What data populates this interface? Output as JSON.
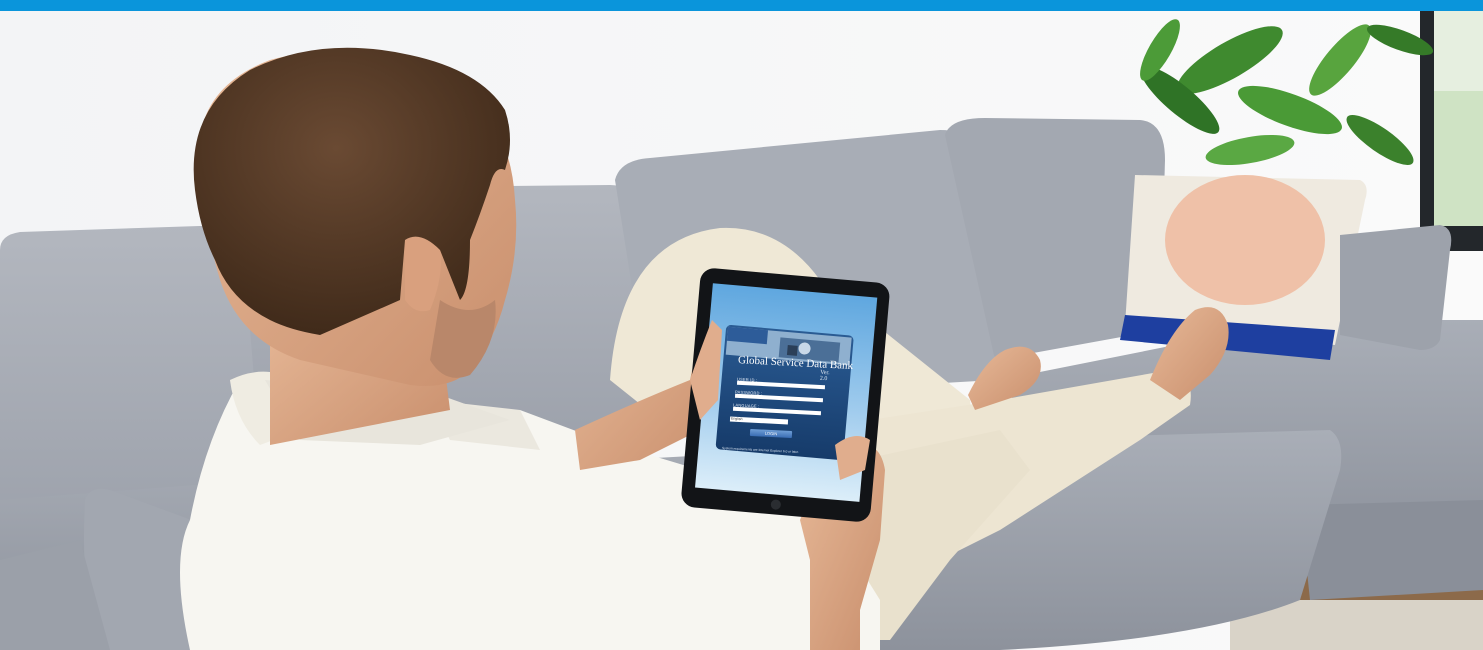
{
  "colors": {
    "top_bar": "#0a95db",
    "sofa": "#a4a9b3",
    "wall": "#f5f6f7",
    "shirt": "#f7f6f1",
    "tablet_screen_blue": "#1f4e84"
  },
  "tablet": {
    "title": "Global Service Data Bank",
    "version": "Ver. 2.0",
    "user_id_label": "USER ID :",
    "password_label": "PASSWORD :",
    "language_label": "LANGUAGE :",
    "language_value": "English",
    "login_label": "LOGIN",
    "footer_note": "System requirements are Internet Explorer 6.0 or later."
  }
}
